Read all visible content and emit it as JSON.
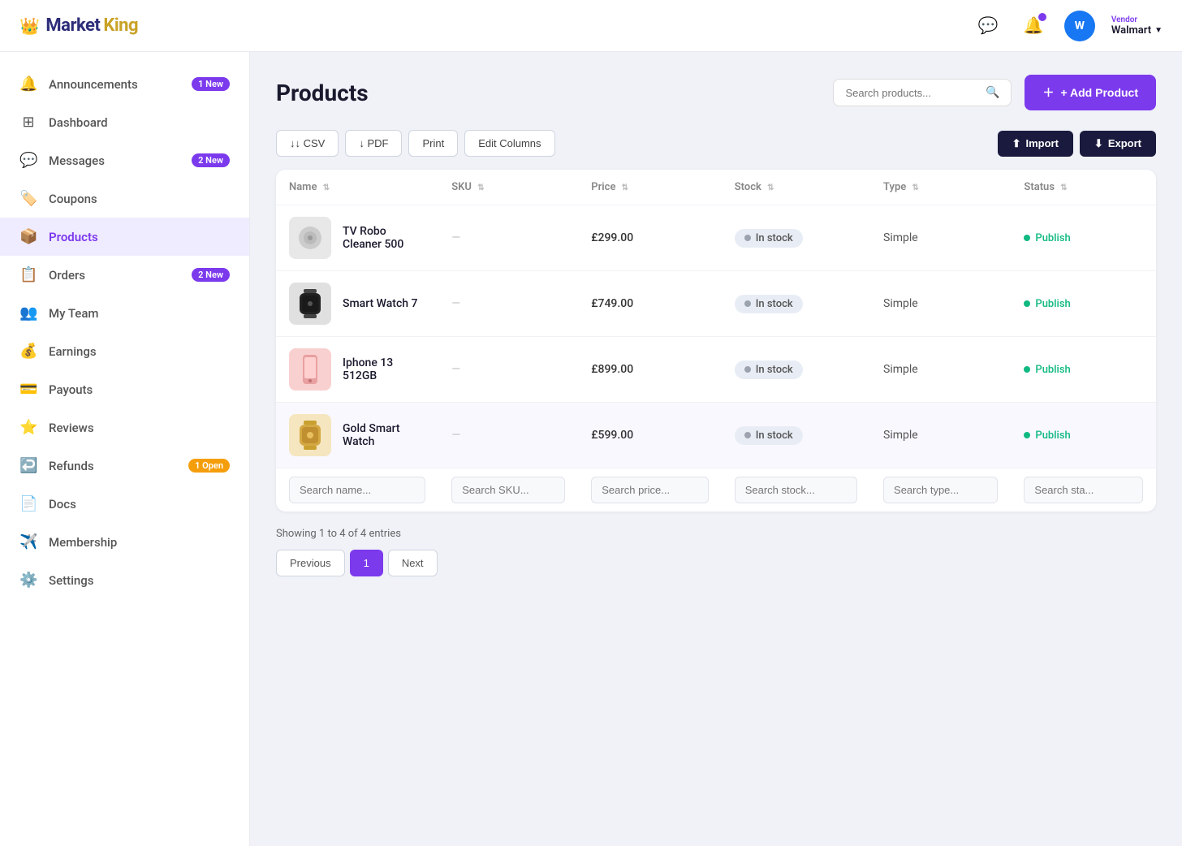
{
  "header": {
    "logo_market": "Market",
    "logo_king": "King",
    "vendor_label": "Vendor",
    "vendor_name": "Walmart",
    "vendor_initials": "W"
  },
  "sidebar": {
    "items": [
      {
        "id": "announcements",
        "label": "Announcements",
        "badge": "1 New",
        "badge_type": "new",
        "icon": "🔔"
      },
      {
        "id": "dashboard",
        "label": "Dashboard",
        "badge": null,
        "icon": "⊞"
      },
      {
        "id": "messages",
        "label": "Messages",
        "badge": "2 New",
        "badge_type": "new",
        "icon": "💬"
      },
      {
        "id": "coupons",
        "label": "Coupons",
        "badge": null,
        "icon": "🏷️"
      },
      {
        "id": "products",
        "label": "Products",
        "badge": null,
        "icon": "📦",
        "active": true
      },
      {
        "id": "orders",
        "label": "Orders",
        "badge": "2 New",
        "badge_type": "new",
        "icon": "📋"
      },
      {
        "id": "myteam",
        "label": "My Team",
        "badge": null,
        "icon": "👥"
      },
      {
        "id": "earnings",
        "label": "Earnings",
        "badge": null,
        "icon": "💰"
      },
      {
        "id": "payouts",
        "label": "Payouts",
        "badge": null,
        "icon": "💳"
      },
      {
        "id": "reviews",
        "label": "Reviews",
        "badge": null,
        "icon": "⭐"
      },
      {
        "id": "refunds",
        "label": "Refunds",
        "badge": "1 Open",
        "badge_type": "open",
        "icon": "↩️"
      },
      {
        "id": "docs",
        "label": "Docs",
        "badge": null,
        "icon": "📄"
      },
      {
        "id": "membership",
        "label": "Membership",
        "badge": null,
        "icon": "✈️"
      },
      {
        "id": "settings",
        "label": "Settings",
        "badge": null,
        "icon": "⚙️"
      }
    ]
  },
  "page": {
    "title": "Products",
    "search_placeholder": "Search products...",
    "add_product_label": "+ Add Product"
  },
  "toolbar": {
    "csv_label": "↓ CSV",
    "pdf_label": "↓ PDF",
    "print_label": "Print",
    "edit_columns_label": "Edit Columns",
    "import_label": "Import",
    "export_label": "Export"
  },
  "table": {
    "columns": [
      {
        "id": "name",
        "label": "Name"
      },
      {
        "id": "sku",
        "label": "SKU"
      },
      {
        "id": "price",
        "label": "Price"
      },
      {
        "id": "stock",
        "label": "Stock"
      },
      {
        "id": "type",
        "label": "Type"
      },
      {
        "id": "status",
        "label": "Status"
      }
    ],
    "rows": [
      {
        "id": 1,
        "name": "TV Robo Cleaner 500",
        "sku": "—",
        "price": "£299.00",
        "stock": "In stock",
        "type": "Simple",
        "status": "Publish",
        "img_type": "tv-cleaner",
        "selected": false
      },
      {
        "id": 2,
        "name": "Smart Watch 7",
        "sku": "—",
        "price": "£749.00",
        "stock": "In stock",
        "type": "Simple",
        "status": "Publish",
        "img_type": "smartwatch-black",
        "selected": false
      },
      {
        "id": 3,
        "name": "Iphone 13 512GB",
        "sku": "—",
        "price": "£899.00",
        "stock": "In stock",
        "type": "Simple",
        "status": "Publish",
        "img_type": "iphone-pink",
        "selected": false
      },
      {
        "id": 4,
        "name": "Gold Smart Watch",
        "sku": "—",
        "price": "£599.00",
        "stock": "In stock",
        "type": "Simple",
        "status": "Publish",
        "img_type": "smartwatch-gold",
        "selected": true
      }
    ],
    "search_placeholders": {
      "name": "Search name...",
      "sku": "Search SKU...",
      "price": "Search price...",
      "stock": "Search stock...",
      "type": "Search type...",
      "status": "Search sta..."
    }
  },
  "pagination": {
    "showing_text": "Showing 1 to 4 of 4 entries",
    "previous_label": "Previous",
    "next_label": "Next",
    "current_page": 1,
    "pages": [
      1
    ]
  }
}
